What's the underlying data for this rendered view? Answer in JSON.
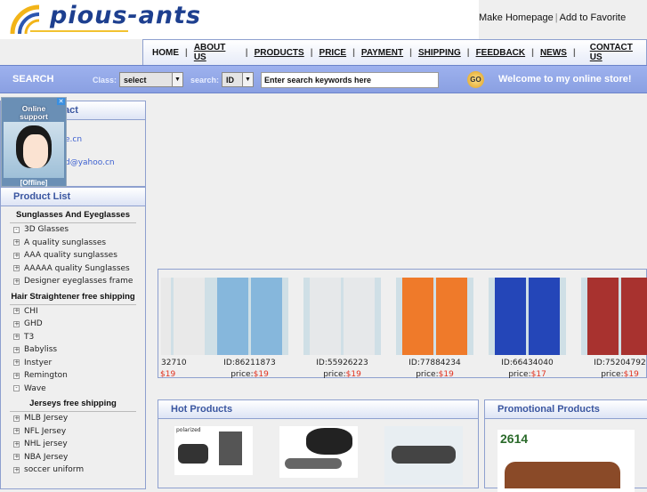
{
  "header": {
    "logo": "pious-ants",
    "links": [
      "Make Homepage",
      "Add to Favorite"
    ]
  },
  "nav": [
    "HOME",
    "ABOUT US",
    "PRODUCTS",
    "PRICE",
    "PAYMENT",
    "SHIPPING",
    "FEEDBACK",
    "NEWS",
    "CONTACT US"
  ],
  "search": {
    "title": "SEARCH",
    "class_label": "Class:",
    "class_value": "select",
    "search_label": "search:",
    "search_value": "ID",
    "placeholder": "Enter search keywords here",
    "go": "GO",
    "welcome": "Welcome to my online store!"
  },
  "contact": {
    "title": "Contact",
    "email1": "e.cn",
    "email2": "d@yahoo.cn"
  },
  "support": {
    "title1": "Online",
    "title2": "support",
    "status": "[Offline]"
  },
  "product_list": {
    "title": "Product List",
    "groups": [
      {
        "name": "Sunglasses And Eyeglasses",
        "items": [
          [
            "3D Glasses",
            "-"
          ],
          [
            "A quality sunglasses",
            "+"
          ],
          [
            "AAA quality sunglasses",
            "+"
          ],
          [
            "AAAAA quality Sunglasses",
            "+"
          ],
          [
            "Designer eyeglasses frame",
            "+"
          ]
        ]
      },
      {
        "name": "Hair Straightener free shipping",
        "items": [
          [
            "CHI",
            "+"
          ],
          [
            "GHD",
            "+"
          ],
          [
            "T3",
            "+"
          ],
          [
            "Babyliss",
            "+"
          ],
          [
            "Instyer",
            "+"
          ],
          [
            "Remington",
            "+"
          ],
          [
            "Wave",
            "-"
          ]
        ]
      },
      {
        "name": "Jerseys free shipping",
        "items": [
          [
            "MLB Jersey",
            "+"
          ],
          [
            "NFL Jersey",
            "+"
          ],
          [
            "NHL jersey",
            "+"
          ],
          [
            "NBA Jersey",
            "+"
          ],
          [
            "soccer uniform",
            "+"
          ]
        ]
      }
    ]
  },
  "gallery": [
    {
      "id": "32710",
      "price": "$19",
      "color": "#e9e9e9"
    },
    {
      "id": "ID:86211873",
      "price_label": "price:",
      "price": "$19",
      "color": "#86b7dc"
    },
    {
      "id": "ID:55926223",
      "price_label": "price:",
      "price": "$19",
      "color": "#e6e8ea"
    },
    {
      "id": "ID:77884234",
      "price_label": "price:",
      "price": "$19",
      "color": "#ef7a2a"
    },
    {
      "id": "ID:66434040",
      "price_label": "price:",
      "price": "$17",
      "color": "#2446b8"
    },
    {
      "id": "ID:75204792",
      "price_label": "price:",
      "price": "$19",
      "color": "#a8322f"
    }
  ],
  "hot": {
    "title": "Hot Products",
    "tag": "polarized"
  },
  "promo": {
    "title": "Promotional Products",
    "code": "2614"
  },
  "colors": {
    "accent": "#3a56a0",
    "price": "#e0301e",
    "border": "#8ea0cf"
  }
}
